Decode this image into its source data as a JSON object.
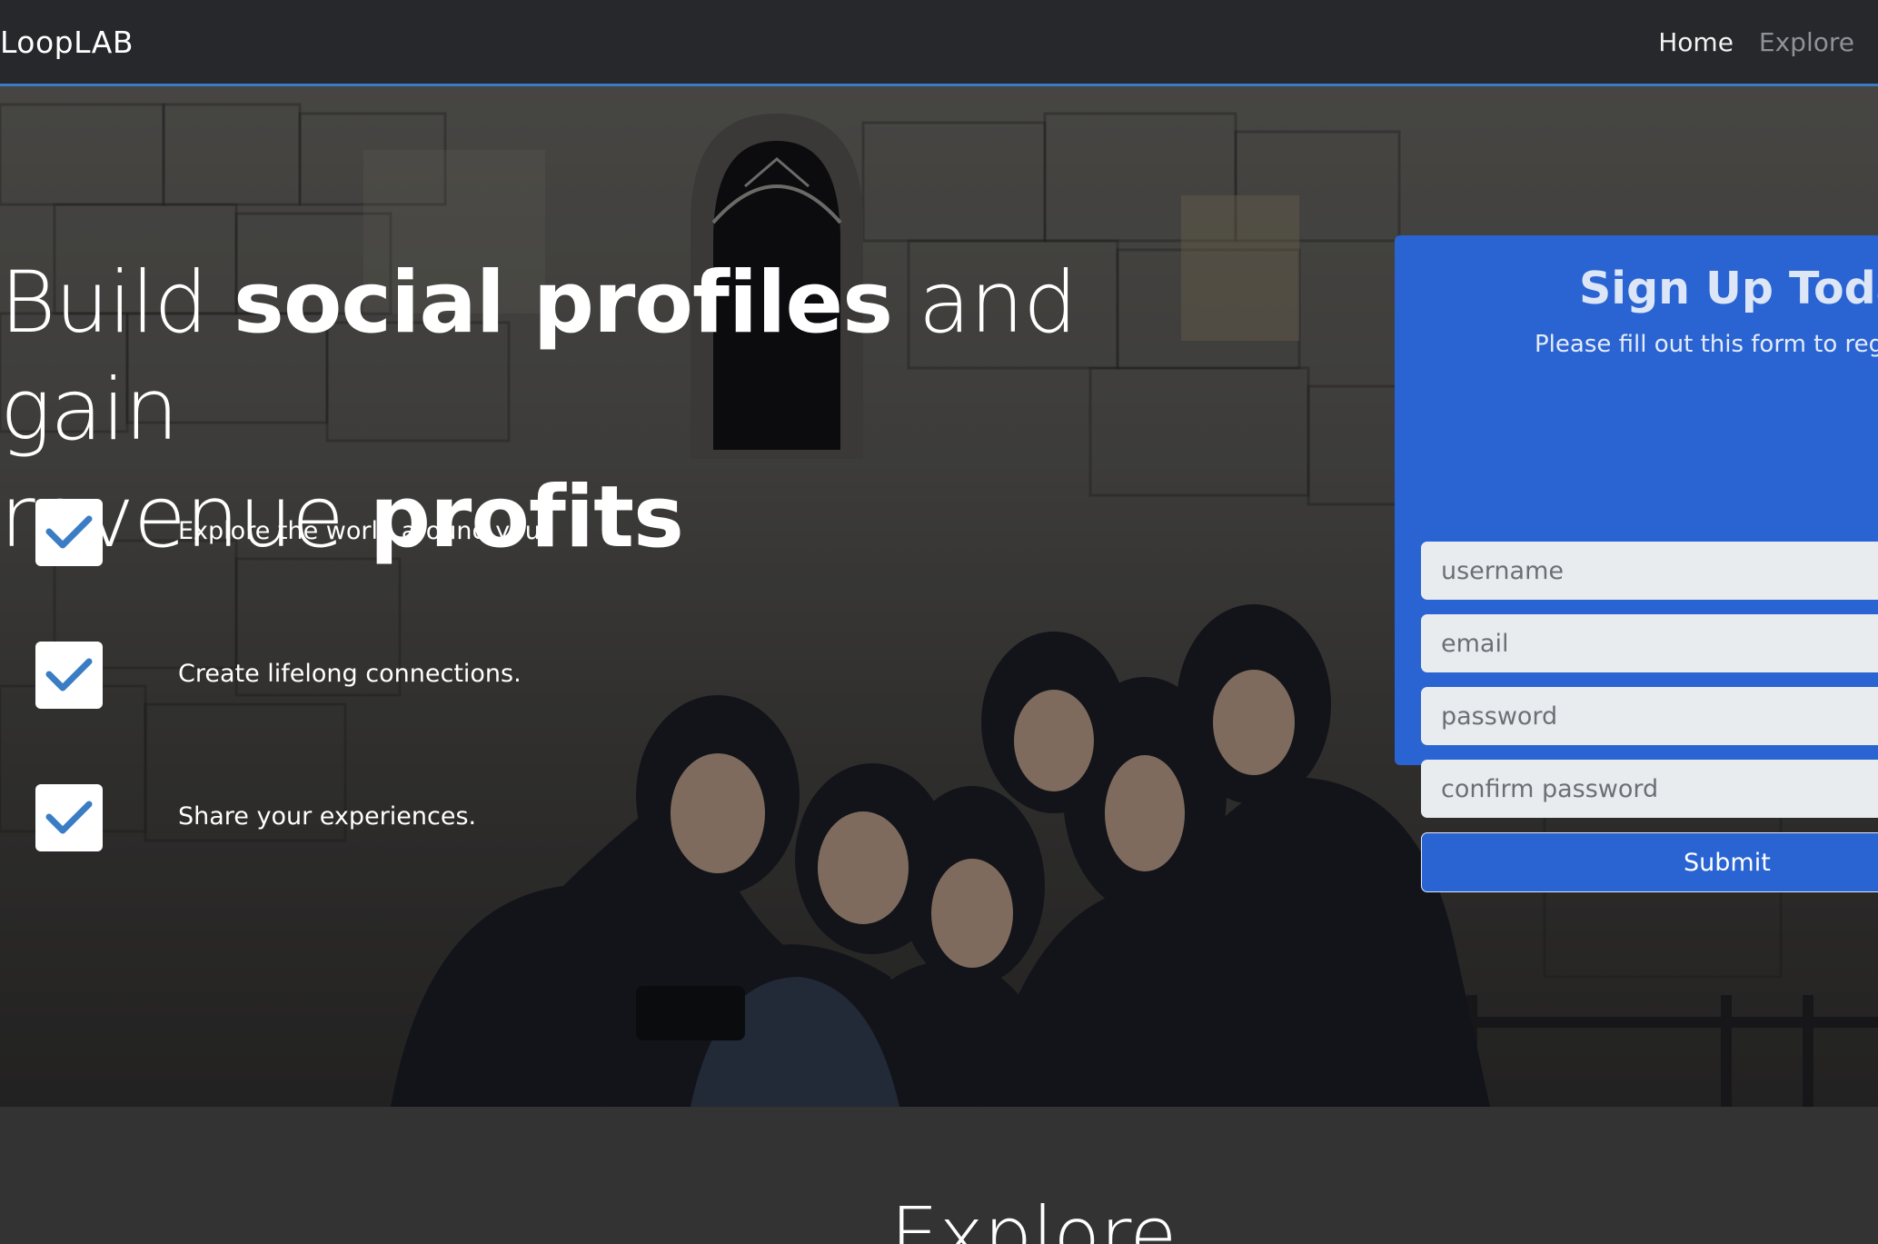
{
  "navbar": {
    "brand": "LoopLAB",
    "links": [
      {
        "label": "Home"
      },
      {
        "label": "Explore"
      }
    ]
  },
  "hero": {
    "headline": {
      "line1_light_a": "Build ",
      "line1_bold": "social profiles",
      "line1_light_b": " and gain",
      "line2_light": "revenue ",
      "line2_bold": "profits"
    },
    "features": [
      {
        "text": "Explore the world around you.",
        "icon": "checkmark-icon"
      },
      {
        "text": "Create lifelong connections.",
        "icon": "checkmark-icon"
      },
      {
        "text": "Share your experiences.",
        "icon": "checkmark-icon"
      }
    ]
  },
  "signup": {
    "title": "Sign Up Today",
    "subtitle": "Please fill out this form to regis",
    "fields": {
      "username_placeholder": "username",
      "email_placeholder": "email",
      "password_placeholder": "password",
      "confirm_placeholder": "confirm password"
    },
    "submit_label": "Submit"
  },
  "explore_section": {
    "heading": "Explore"
  },
  "colors": {
    "accent": "#3b7dc4",
    "card": "#2a64d3",
    "navbar": "#26282b",
    "section_bg": "#333333"
  }
}
